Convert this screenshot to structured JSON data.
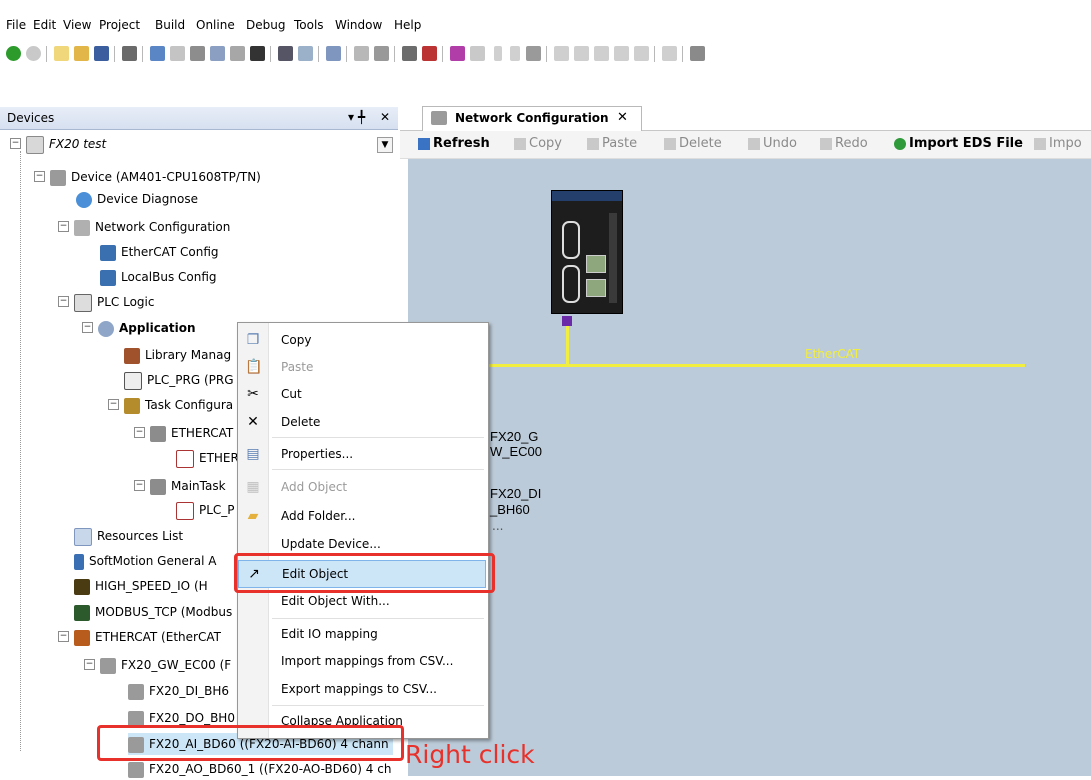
{
  "menubar": {
    "items": [
      "File",
      "Edit",
      "View",
      "Project",
      "Build",
      "Online",
      "Debug",
      "Tools",
      "Window",
      "Help"
    ]
  },
  "devices_panel": {
    "title": "Devices",
    "pin_glyph": "▾ ╇",
    "close_glyph": "✕",
    "tree": [
      {
        "label": "FX20 test",
        "icon": "project-icon"
      },
      {
        "label": "Device (AM401-CPU1608TP/TN)",
        "icon": "device-icon"
      },
      {
        "label": "Device Diagnose",
        "icon": "diagnose-icon"
      },
      {
        "label": "Network Configuration",
        "icon": "network-icon"
      },
      {
        "label": "EtherCAT Config",
        "icon": "ethercat-config-icon"
      },
      {
        "label": "LocalBus Config",
        "icon": "localbus-config-icon"
      },
      {
        "label": "PLC Logic",
        "icon": "plc-logic-icon"
      },
      {
        "label": "Application",
        "icon": "application-icon"
      },
      {
        "label": "Library Manag",
        "icon": "library-icon"
      },
      {
        "label": "PLC_PRG (PRG",
        "icon": "program-icon"
      },
      {
        "label": "Task Configura",
        "icon": "task-config-icon"
      },
      {
        "label": "ETHERCAT",
        "icon": "task-icon"
      },
      {
        "label": "ETHER",
        "icon": "task-call-icon"
      },
      {
        "label": "MainTask",
        "icon": "task-icon"
      },
      {
        "label": "PLC_P",
        "icon": "task-call-icon"
      },
      {
        "label": "Resources List",
        "icon": "resources-icon"
      },
      {
        "label": "SoftMotion General A",
        "icon": "softmotion-icon"
      },
      {
        "label": "HIGH_SPEED_IO (H",
        "icon": "io-icon"
      },
      {
        "label": "MODBUS_TCP (Modbus",
        "icon": "modbus-icon"
      },
      {
        "label": "ETHERCAT (EtherCAT",
        "icon": "ethercat-master-icon"
      },
      {
        "label": "FX20_GW_EC00 (F",
        "icon": "module-icon"
      },
      {
        "label": "FX20_DI_BH6",
        "icon": "module-icon"
      },
      {
        "label": "FX20_DO_BH0",
        "icon": "module-icon"
      },
      {
        "label": "FX20_AI_BD60 ((FX20-AI-BD60) 4 chann",
        "icon": "module-icon"
      },
      {
        "label": "FX20_AO_BD60_1 ((FX20-AO-BD60) 4 ch",
        "icon": "module-icon"
      }
    ]
  },
  "editor": {
    "tab_label": "Network Configuration",
    "tab_close": "✕",
    "toolbar": {
      "refresh": "Refresh",
      "copy": "Copy",
      "paste": "Paste",
      "delete": "Delete",
      "undo": "Undo",
      "redo": "Redo",
      "import_eds": "Import EDS File",
      "import_more": "Impo"
    },
    "canvas": {
      "bus_label": "EtherCAT",
      "node1_line1": "FX20_G",
      "node1_line2": "W_EC00",
      "node2_line1": "FX20_DI",
      "node2_line2": "_BH60",
      "more": "..."
    }
  },
  "context_menu": {
    "items": [
      {
        "label": "Copy",
        "enabled": true,
        "icon": "copy-icon"
      },
      {
        "label": "Paste",
        "enabled": false,
        "icon": "paste-icon"
      },
      {
        "label": "Cut",
        "enabled": true,
        "icon": "cut-icon"
      },
      {
        "label": "Delete",
        "enabled": true,
        "icon": "delete-icon"
      },
      {
        "label": "Properties...",
        "enabled": true,
        "icon": "properties-icon"
      },
      {
        "label": "Add Object",
        "enabled": false,
        "icon": "add-object-icon"
      },
      {
        "label": "Add Folder...",
        "enabled": true,
        "icon": "folder-icon"
      },
      {
        "label": "Update Device...",
        "enabled": true,
        "icon": ""
      },
      {
        "label": "Edit Object",
        "enabled": true,
        "icon": "edit-object-icon",
        "highlighted": true
      },
      {
        "label": "Edit Object With...",
        "enabled": true,
        "icon": ""
      },
      {
        "label": "Edit IO mapping",
        "enabled": true,
        "icon": ""
      },
      {
        "label": "Import mappings from CSV...",
        "enabled": true,
        "icon": ""
      },
      {
        "label": "Export mappings to CSV...",
        "enabled": true,
        "icon": ""
      },
      {
        "label": "Collapse Application",
        "enabled": true,
        "icon": ""
      }
    ]
  },
  "annotation": {
    "text": "Right click",
    "color": "#e8312a"
  },
  "colors": {
    "canvas_bg": "#bccbd9",
    "bus_line": "#f2ee3f",
    "highlight": "#cde6f7",
    "annotation_red": "#e8312a"
  }
}
